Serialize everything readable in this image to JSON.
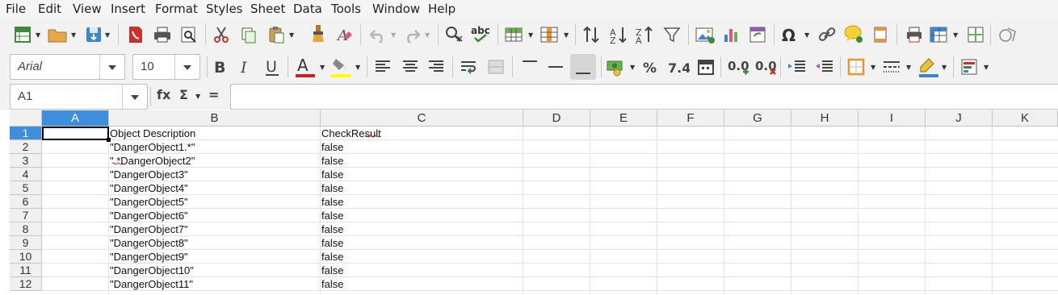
{
  "menu": [
    "File",
    "Edit",
    "View",
    "Insert",
    "Format",
    "Styles",
    "Sheet",
    "Data",
    "Tools",
    "Window",
    "Help"
  ],
  "toolbar1_icons": [
    "new-document",
    "open-folder",
    "save",
    "export-pdf",
    "print",
    "print-preview",
    "cut",
    "copy",
    "paste",
    "clone-formatting",
    "clear-formatting",
    "undo",
    "redo",
    "find-replace",
    "spelling",
    "row",
    "column",
    "sort",
    "sort-ascending",
    "sort-descending",
    "autofilter",
    "image",
    "chart",
    "pivot-table",
    "special-character",
    "hyperlink",
    "comment",
    "headers-footers",
    "define-print-area",
    "freeze-rows-columns",
    "split-window",
    "show-draw-functions"
  ],
  "font": {
    "name": "Arial",
    "size": "10"
  },
  "colors": {
    "font_color": "#c9211e",
    "highlight": "#ffff00",
    "selection": "#3f8ede",
    "cursor_border": "#000000"
  },
  "formula_bar": {
    "name_box": "A1",
    "function_wizard_label": "fx",
    "sum_label": "Σ",
    "equals_label": "=",
    "content": ""
  },
  "columns": [
    "A",
    "B",
    "C",
    "D",
    "E",
    "F",
    "G",
    "H",
    "I",
    "J",
    "K"
  ],
  "selected_cell": "A1",
  "rows": [
    {
      "num": "1",
      "b": "Object Description",
      "c": "CheckResult"
    },
    {
      "num": "2",
      "b": "\"DangerObject1.*\"",
      "c": "false"
    },
    {
      "num": "3",
      "b": "\".*DangerObject2\"",
      "c": "false"
    },
    {
      "num": "4",
      "b": "\"DangerObject3\"",
      "c": "false"
    },
    {
      "num": "5",
      "b": "\"DangerObject4\"",
      "c": "false"
    },
    {
      "num": "6",
      "b": "\"DangerObject5\"",
      "c": "false"
    },
    {
      "num": "7",
      "b": "\"DangerObject6\"",
      "c": "false"
    },
    {
      "num": "8",
      "b": "\"DangerObject7\"",
      "c": "false"
    },
    {
      "num": "9",
      "b": "\"DangerObject8\"",
      "c": "false"
    },
    {
      "num": "10",
      "b": "\"DangerObject9\"",
      "c": "false"
    },
    {
      "num": "11",
      "b": "\"DangerObject10\"",
      "c": "false"
    },
    {
      "num": "12",
      "b": "\"DangerObject11\"",
      "c": "false"
    }
  ]
}
